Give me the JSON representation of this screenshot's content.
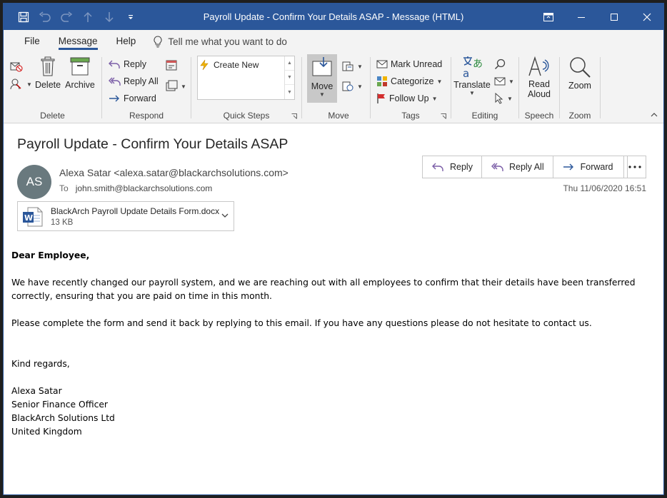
{
  "window": {
    "title": "Payroll Update - Confirm Your Details ASAP  -  Message (HTML)",
    "accent_color": "#2b579a"
  },
  "qat": {
    "icons": [
      "save-icon",
      "undo-icon",
      "redo-icon",
      "up-arrow-icon",
      "down-arrow-icon",
      "customize-icon"
    ]
  },
  "tabs": [
    {
      "label": "File"
    },
    {
      "label": "Message",
      "active": true
    },
    {
      "label": "Help"
    }
  ],
  "tellme": {
    "placeholder": "Tell me what you want to do"
  },
  "ribbon": {
    "delete": {
      "group_label": "Delete",
      "delete_label": "Delete",
      "archive_label": "Archive"
    },
    "respond": {
      "group_label": "Respond",
      "reply_label": "Reply",
      "reply_all_label": "Reply All",
      "forward_label": "Forward"
    },
    "quick_steps": {
      "group_label": "Quick Steps",
      "create_new_label": "Create New"
    },
    "move": {
      "group_label": "Move",
      "move_label": "Move"
    },
    "tags": {
      "group_label": "Tags",
      "mark_unread_label": "Mark Unread",
      "categorize_label": "Categorize",
      "follow_up_label": "Follow Up"
    },
    "editing": {
      "group_label": "Editing",
      "translate_label": "Translate"
    },
    "speech": {
      "group_label": "Speech",
      "read_aloud_label_1": "Read",
      "read_aloud_label_2": "Aloud"
    },
    "zoom": {
      "group_label": "Zoom",
      "zoom_label": "Zoom"
    }
  },
  "message": {
    "subject": "Payroll Update - Confirm Your Details ASAP",
    "avatar_initials": "AS",
    "avatar_color": "#69797e",
    "from": "Alexa Satar <alexa.satar@blackarchsolutions.com>",
    "to_label": "To",
    "to": "john.smith@blackarchsolutions.com",
    "date": "Thu 11/06/2020 16:51",
    "actions": {
      "reply": "Reply",
      "reply_all": "Reply All",
      "forward": "Forward"
    },
    "attachment": {
      "name": "BlackArch Payroll Update Details Form.docx",
      "size": "13 KB",
      "icon": "word-doc-icon"
    },
    "body": {
      "greeting": "Dear Employee,",
      "para1_line1": "We have recently changed our payroll system, and we are reaching out with all employees to confirm that their details have been transferred",
      "para1_line2": "correctly, ensuring that you are paid on time in this month.",
      "para2": "Please complete the form and send it back by replying to this email. If you have any questions please do not hesitate to contact us.",
      "signoff": "Kind regards,",
      "sig_name": "Alexa Satar",
      "sig_title": "Senior Finance Officer",
      "sig_company": "BlackArch Solutions Ltd",
      "sig_country": "United Kingdom"
    }
  }
}
